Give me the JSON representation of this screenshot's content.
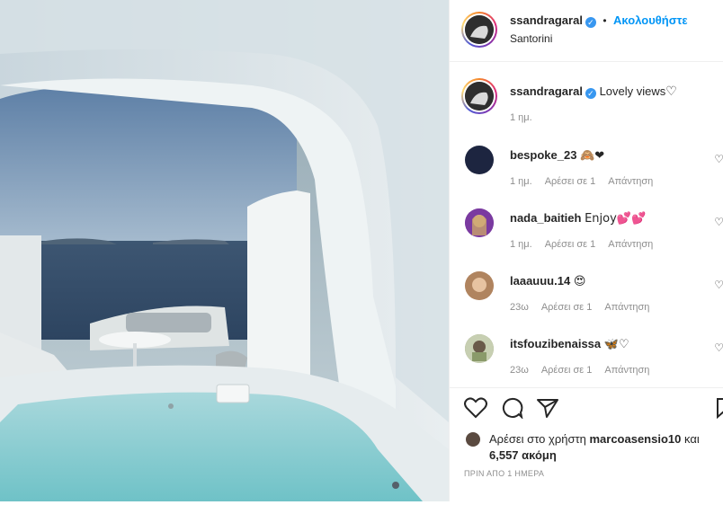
{
  "post": {
    "author": "ssandragaral",
    "location": "Santorini",
    "follow_label": "Ακολουθήστε",
    "separator": "•",
    "caption_text": "Lovely views",
    "caption_time": "1 ημ."
  },
  "comments": [
    {
      "user": "bespoke_23",
      "text": "🙈❤",
      "time": "1 ημ.",
      "likes": "Αρέσει σε 1",
      "reply": "Απάντηση",
      "avatar_color": "#1d2540"
    },
    {
      "user": "nada_baitieh",
      "text": "Enjoy💕💕",
      "time": "1 ημ.",
      "likes": "Αρέσει σε 1",
      "reply": "Απάντηση",
      "avatar_color": "#7a3aa0"
    },
    {
      "user": "laaauuu.14",
      "text": "😍",
      "time": "23ω",
      "likes": "Αρέσει σε 1",
      "reply": "Απάντηση",
      "avatar_color": "#c89b7b"
    },
    {
      "user": "itsfouzibenaissa",
      "text": "🦋♡",
      "time": "23ω",
      "likes": "Αρέσει σε 1",
      "reply": "Απάντηση",
      "avatar_color": "#9aa57a"
    }
  ],
  "likes": {
    "prefix": "Αρέσει στο χρήστη",
    "user": "marcoasensio10",
    "suffix": "και",
    "count": "6,557 ακόμη"
  },
  "date_label": "ΠΡΙΝ ΑΠΟ 1 ΗΜΕΡΑ",
  "colors": {
    "accent": "#0095f6",
    "verified": "#3897f0",
    "text": "#262626",
    "muted": "#8e8e8e"
  },
  "icons": [
    "heart-icon",
    "comment-icon",
    "share-icon",
    "bookmark-icon",
    "verified-badge-icon",
    "more-icon"
  ]
}
